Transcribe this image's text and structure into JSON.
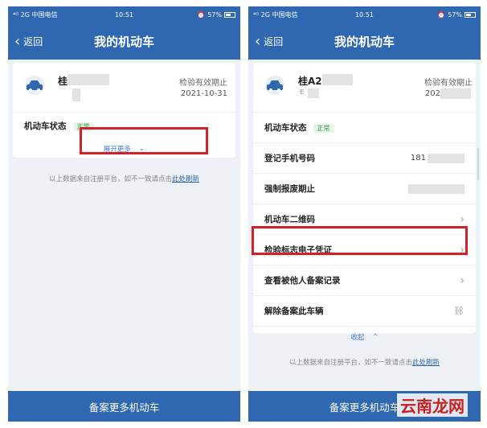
{
  "status_bar": {
    "left": "⁴ᴳ 2G 中国电信",
    "time": "10:51",
    "battery": "57%"
  },
  "left_screen": {
    "back_label": "返回",
    "title": "我的机动车",
    "plate": "桂",
    "inspection_label": "检验有效期止",
    "inspection_date": "2021-10-31",
    "status_label": "机动车状态",
    "status_value": "正常",
    "expand_label": "展开更多",
    "note_text": "以上数据来自注册平台，如不一致请点击",
    "note_link": "此处刷新",
    "bottom_button": "备案更多机动车"
  },
  "right_screen": {
    "back_label": "返回",
    "title": "我的机动车",
    "plate": "桂A2",
    "plate_sub": "·E",
    "inspection_label": "检验有效期止",
    "inspection_date_prefix": "202",
    "rows": {
      "status": "机动车状态",
      "status_value": "正常",
      "phone": "登记手机号码",
      "phone_value_prefix": "181",
      "insurance": "强制报废期止",
      "qrcode": "机动车二维码",
      "e_cert": "检验标志电子凭证",
      "others": "查看被他人备案记录",
      "unbind": "解除备案此车辆"
    },
    "collapse_label": "收起",
    "note_text": "以上数据来自注册平台，如不一致请点击",
    "note_link": "此处刷新",
    "bottom_button": "备案更多机动车",
    "watermark": "云南龙网"
  },
  "colors": {
    "brand_blue": "#2f67b1",
    "status_green": "#3aa04b",
    "highlight_red": "#d42027"
  }
}
